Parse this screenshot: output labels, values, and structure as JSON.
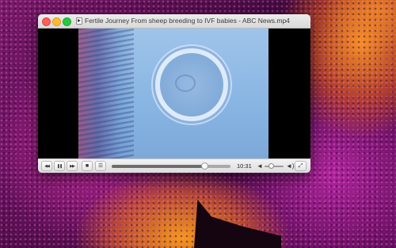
{
  "window": {
    "title": "Fertile Journey From sheep breeding to IVF babies - ABC News.mp4"
  },
  "video": {
    "watermark": ")))"
  },
  "controls": {
    "rewind_icon": "rewind-icon",
    "pause_icon": "pause-icon",
    "forward_icon": "fast-forward-icon",
    "stop_icon": "stop-icon",
    "playlist_icon": "playlist-icon",
    "fullscreen_icon": "fullscreen-icon",
    "time_remaining": "10:31",
    "progress": 0.78,
    "volume_level": 0.35,
    "glyph_rewind": "◀◀",
    "glyph_pause": "❚❚",
    "glyph_forward": "▶▶",
    "glyph_stop": "■",
    "glyph_playlist": "☰",
    "glyph_fullscreen": "⤢",
    "glyph_vol_low": "◄",
    "glyph_vol_high": "◄)"
  },
  "colors": {
    "close": "#fc5f57",
    "minimize": "#fdbc2e",
    "zoom": "#28c840"
  }
}
